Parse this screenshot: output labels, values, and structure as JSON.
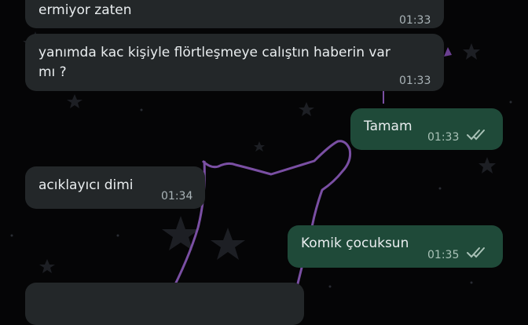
{
  "messages": [
    {
      "direction": "incoming",
      "text": "ermiyor zaten",
      "time": "01:33"
    },
    {
      "direction": "incoming",
      "text_line1": "yanımda kac kişiyle flörtleşmeye calıştın haberin var",
      "text_line2": "mı ?",
      "time": "01:33"
    },
    {
      "direction": "outgoing",
      "text": "Tamam",
      "time": "01:33",
      "status": "read-double-check-icon"
    },
    {
      "direction": "incoming",
      "text": "acıklayıcı dimi",
      "time": "01:34"
    },
    {
      "direction": "outgoing",
      "text": "Komik çocuksun",
      "time": "01:35",
      "status": "read-double-check-icon"
    },
    {
      "direction": "incoming",
      "text": "",
      "time": ""
    }
  ],
  "colors": {
    "background": "#050506",
    "incoming_bubble": "#232729",
    "outgoing_bubble": "#1f4a39",
    "wallpaper_line": "#7a4fa3"
  }
}
